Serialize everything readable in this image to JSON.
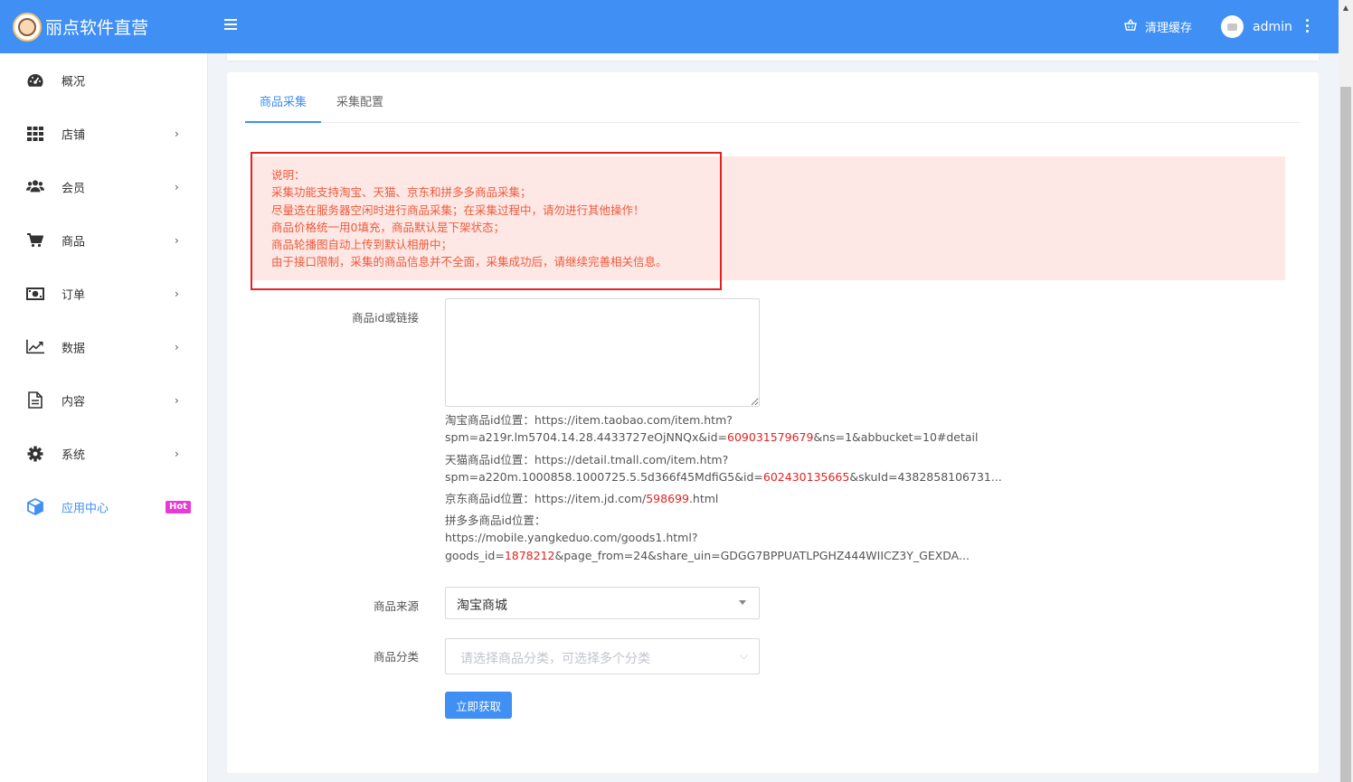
{
  "header": {
    "brand_title": "丽点软件直营",
    "clear_cache_label": "清理缓存",
    "username": "admin"
  },
  "sidebar": {
    "items": [
      {
        "label": "概况",
        "icon": "dashboard-icon",
        "has_submenu": false
      },
      {
        "label": "店铺",
        "icon": "grid-icon",
        "has_submenu": true
      },
      {
        "label": "会员",
        "icon": "users-icon",
        "has_submenu": true
      },
      {
        "label": "商品",
        "icon": "cart-icon",
        "has_submenu": true
      },
      {
        "label": "订单",
        "icon": "money-icon",
        "has_submenu": true
      },
      {
        "label": "数据",
        "icon": "chart-line-icon",
        "has_submenu": true
      },
      {
        "label": "内容",
        "icon": "document-icon",
        "has_submenu": true
      },
      {
        "label": "系统",
        "icon": "gear-icon",
        "has_submenu": true
      },
      {
        "label": "应用中心",
        "icon": "cube-icon",
        "badge": "Hot",
        "active": true
      }
    ]
  },
  "tabs": [
    {
      "label": "商品采集",
      "active": true
    },
    {
      "label": "采集配置",
      "active": false
    }
  ],
  "notice": {
    "lines": [
      "说明：",
      "采集功能支持淘宝、天猫、京东和拼多多商品采集；",
      "尽量选在服务器空闲时进行商品采集；在采集过程中，请勿进行其他操作！",
      "商品价格统一用0填充，商品默认是下架状态；",
      "商品轮播图自动上传到默认相册中；",
      "由于接口限制，采集的商品信息并不全面，采集成功后，请继续完善相关信息。"
    ]
  },
  "form": {
    "id_label": "商品id或链接",
    "id_value": "",
    "help": {
      "taobao": {
        "prefix": "淘宝商品id位置：https://item.taobao.com/item.htm?",
        "line2_pre": "spm=a219r.lm5704.14.28.4433727eOjNNQx&id=",
        "id": "609031579679",
        "line2_post": "&ns=1&abbucket=10#detail"
      },
      "tmall": {
        "prefix": "天猫商品id位置：https://detail.tmall.com/item.htm?",
        "line2_pre": "spm=a220m.1000858.1000725.5.5d366f45MdfiG5&id=",
        "id": "602430135665",
        "line2_post": "&skuId=4382858106731..."
      },
      "jd": {
        "pre": "京东商品id位置：https://item.jd.com/",
        "id": "598699",
        "post": ".html"
      },
      "pdd": {
        "line1": "拼多多商品id位置：",
        "line2": "https://mobile.yangkeduo.com/goods1.html?",
        "line3_pre": "goods_id=",
        "id": "1878212",
        "line3_post": "&page_from=24&share_uin=GDGG7BPPUATLPGHZ444WIICZ3Y_GEXDA..."
      }
    },
    "source_label": "商品来源",
    "source_value": "淘宝商城",
    "category_label": "商品分类",
    "category_placeholder": "请选择商品分类，可选择多个分类",
    "submit_label": "立即获取"
  },
  "colors": {
    "primary": "#3f8ff5",
    "notice_bg": "#fde8e5",
    "notice_text": "#ee5a3c",
    "highlight_border": "#e32222",
    "hot_badge": "#e83bd6"
  }
}
